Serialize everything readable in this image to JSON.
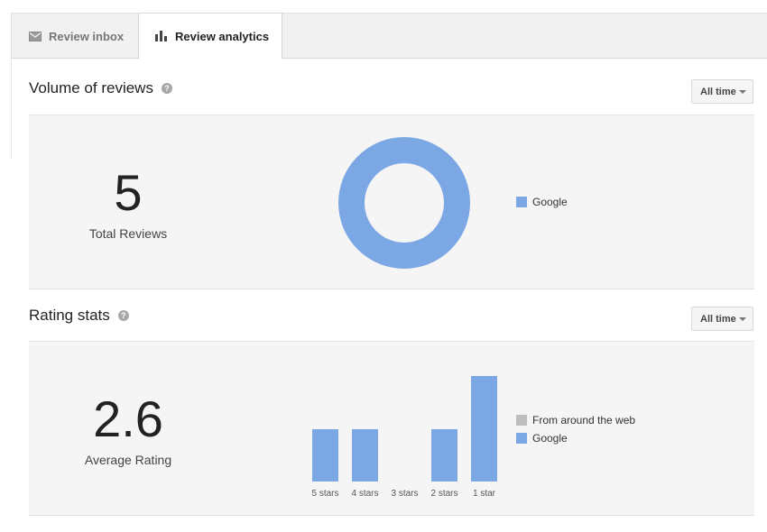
{
  "tabs": {
    "inbox": {
      "label": "Review inbox",
      "icon": "envelope-icon"
    },
    "analytics": {
      "label": "Review analytics",
      "icon": "bar-chart-icon"
    }
  },
  "volume": {
    "title": "Volume of reviews",
    "filter": "All time",
    "total_value": "5",
    "total_label": "Total Reviews",
    "legend": [
      {
        "label": "Google",
        "color": "#7ba7e5"
      }
    ],
    "chart_data": {
      "type": "pie",
      "categories": [
        "Google"
      ],
      "values": [
        5
      ]
    }
  },
  "rating": {
    "title": "Rating stats",
    "filter": "All time",
    "average_value": "2.6",
    "average_label": "Average Rating",
    "legend": [
      {
        "label": "From around the web",
        "color": "#bdbdbd"
      },
      {
        "label": "Google",
        "color": "#7ba7e5"
      }
    ],
    "chart_data": {
      "type": "bar",
      "categories": [
        "5 stars",
        "4 stars",
        "3 stars",
        "2 stars",
        "1 star"
      ],
      "series": [
        {
          "name": "From around the web",
          "values": [
            0,
            0,
            0,
            0,
            0
          ]
        },
        {
          "name": "Google",
          "values": [
            1,
            1,
            0,
            1,
            2
          ]
        }
      ],
      "ylim": [
        0,
        2
      ]
    }
  }
}
